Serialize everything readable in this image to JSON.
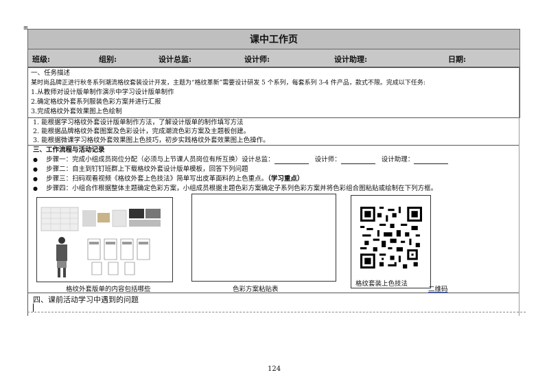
{
  "header": {
    "title": "课中工作页",
    "fields": [
      "班级:",
      "组别:",
      "设计总监:",
      "设计师:",
      "设计助理:",
      "日期:"
    ]
  },
  "task": {
    "heading": "一、任务描述",
    "intro": "某时尚品牌正进行秋冬系列潮流格纹套装设计开发，主题为“格纹革新”需要设计研发 5 个系列，每套系列 3-4 件产品，款式不限。完成以下任务:",
    "items": [
      "1.从教师对设计版单制作演示中学习设计版单制作",
      "2.确定格纹外套系列服装色彩方案并进行汇报",
      "3.完成格纹外套效果图上色绘制"
    ]
  },
  "goals": [
    "1. 能根据学习格纹外套设计版单制作方法，了解设计版单的制作填写方法",
    "2. 能根据品牌格纹外套图案及色彩设计，完成潮流色彩方案及主题板创建。",
    "3. 能根据微课学习格纹外套效果图上色技巧，初步实践格纹外套效果图上色操作。"
  ],
  "workflow": {
    "heading": "三、工作流程与活动记录",
    "step1": {
      "label": "步骤一：",
      "text": "完成小组成员岗位分配（必须与上节课人员岗位有所互换）设计总监：",
      "designer": "设计师：",
      "assistant": "设计助理："
    },
    "step2": {
      "label": "步骤二：",
      "text": "自主到钉钉班群上下载格纹外套设计版单模板，回答下列问题"
    },
    "step3": {
      "label": "步骤三：",
      "text": "扫码观看视频《格纹外套上色技法》简单写出皮革面料的上色重点。",
      "emphasis": "（学习重点）"
    },
    "step4": {
      "label": "步骤四：",
      "text": "小组合作根据整体主题确定色彩方案，小组成员根据主题色彩方案确定子系列色彩方案并将色彩组合图粘贴或绘制在下列方框。"
    }
  },
  "images": {
    "caption1": "格纹外套版单的内容包括哪些",
    "caption2": "色彩方案粘贴表",
    "caption3": "格纹套装上色技法",
    "caption3_suffix": "二维码"
  },
  "pre_class": {
    "heading": "四、课前活动学习中遇到的问题"
  },
  "footer": {
    "page_number": "124"
  }
}
